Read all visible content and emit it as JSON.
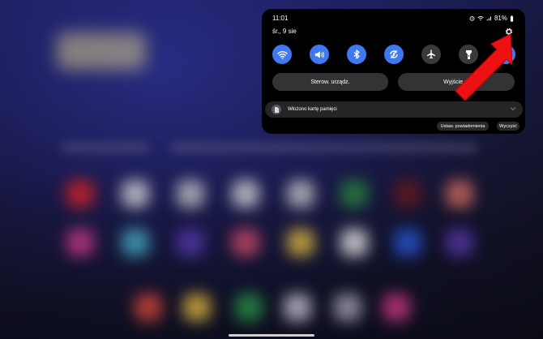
{
  "status_bar": {
    "time": "11:01",
    "battery": "81%"
  },
  "panel": {
    "date": "śr., 9 sie",
    "quick_toggles": [
      {
        "icon": "wifi-icon",
        "state": "on"
      },
      {
        "icon": "sound-icon",
        "state": "on"
      },
      {
        "icon": "bluetooth-icon",
        "state": "on"
      },
      {
        "icon": "auto-rotate-icon",
        "state": "on"
      },
      {
        "icon": "airplane-mode-icon",
        "state": "off"
      },
      {
        "icon": "flashlight-icon",
        "state": "off"
      },
      {
        "icon": "data-transfer-icon",
        "state": "on"
      }
    ],
    "device_control_label": "Sterow. urządz.",
    "media_output_label": "Wyjście m",
    "notification_text": "Włożono kartę pamięci",
    "notification_settings_label": "Ustaw. powiadomienia",
    "clear_label": "Wyczyść"
  },
  "colors": {
    "toggle_on": "#3e78f2",
    "annotation_arrow": "#ee1111"
  }
}
